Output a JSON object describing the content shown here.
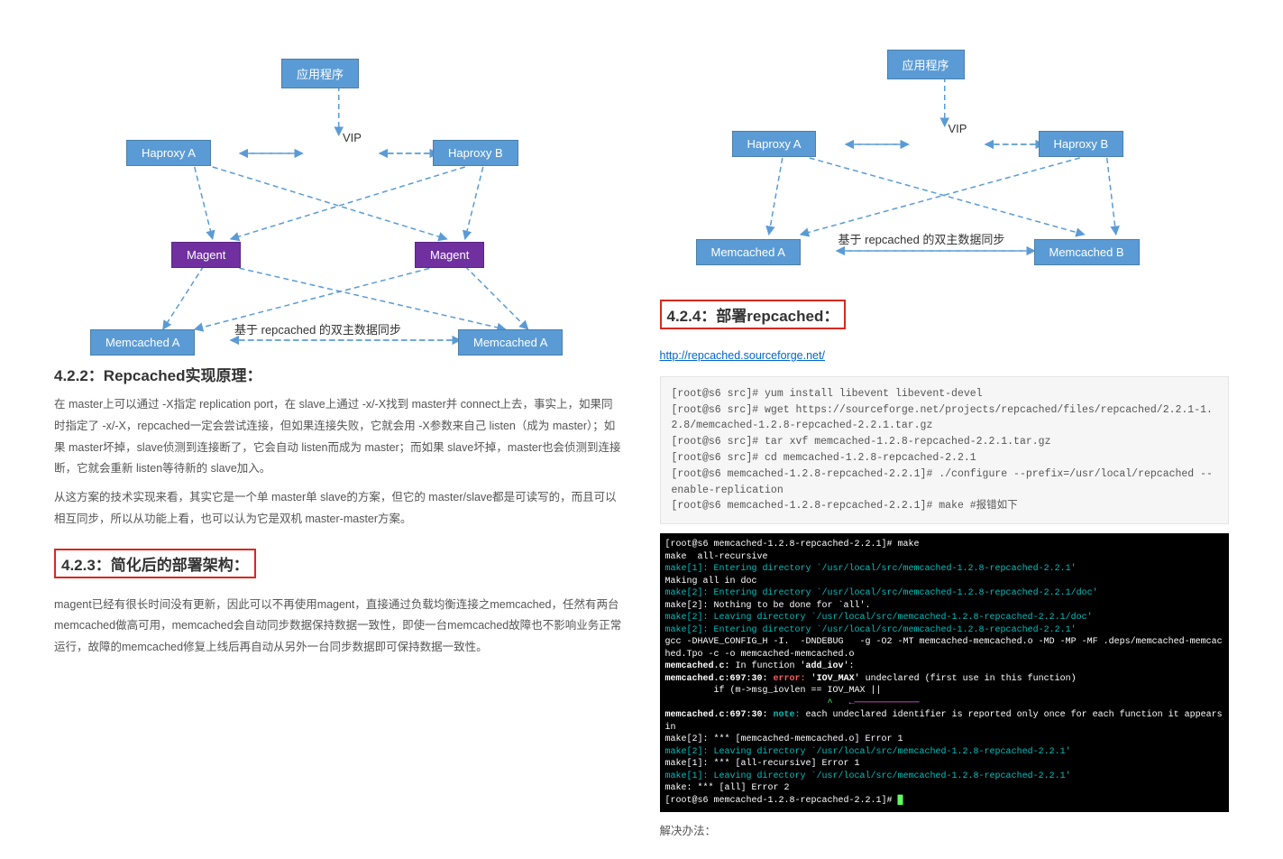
{
  "left": {
    "diag": {
      "app": "应用程序",
      "hapA": "Haproxy A",
      "hapB": "Haproxy B",
      "vip": "VIP",
      "magA": "Magent",
      "magB": "Magent",
      "memA": "Memcached A",
      "memB": "Memcached A",
      "caption": "基于 repcached 的双主数据同步"
    },
    "h422": "4.2.2：Repcached实现原理：",
    "p422a": "在 master上可以通过 -X指定 replication port，在 slave上通过 -x/-X找到 master并 connect上去，事实上，如果同时指定了 -x/-X，repcached一定会尝试连接，但如果连接失败，它就会用 -X参数来自己 listen（成为 master）；如果 master坏掉，slave侦测到连接断了，它会自动 listen而成为 master；而如果 slave坏掉，master也会侦测到连接断，它就会重新 listen等待新的 slave加入。",
    "p422b": "从这方案的技术实现来看，其实它是一个单 master单 slave的方案，但它的 master/slave都是可读写的，而且可以相互同步，所以从功能上看，也可以认为它是双机 master-master方案。",
    "h423": "4.2.3：简化后的部署架构：",
    "p423": "magent已经有很长时间没有更新，因此可以不再使用magent，直接通过负载均衡连接之memcached，任然有两台memcached做高可用，memcached会自动同步数据保持数据一致性，即使一台memcached故障也不影响业务正常运行，故障的memcached修复上线后再自动从另外一台同步数据即可保持数据一致性。"
  },
  "right": {
    "diag": {
      "app": "应用程序",
      "hapA": "Haproxy A",
      "hapB": "Haproxy B",
      "vip": "VIP",
      "memA": "Memcached A",
      "memB": "Memcached B",
      "caption": "基于 repcached 的双主数据同步"
    },
    "h424": "4.2.4：部署repcached：",
    "link": "http://repcached.sourceforge.net/",
    "code": "[root@s6 src]# yum install libevent libevent-devel\n[root@s6 src]# wget https://sourceforge.net/projects/repcached/files/repcached/2.2.1-1.2.8/memcached-1.2.8-repcached-2.2.1.tar.gz\n[root@s6 src]# tar xvf memcached-1.2.8-repcached-2.2.1.tar.gz\n[root@s6 src]# cd memcached-1.2.8-repcached-2.2.1\n[root@s6 memcached-1.2.8-repcached-2.2.1]# ./configure --prefix=/usr/local/repcached --enable-replication\n[root@s6 memcached-1.2.8-repcached-2.2.1]# make #报错如下",
    "term": {
      "l1": "[root@s6 memcached-1.2.8-repcached-2.2.1]# make",
      "l2": "make  all-recursive",
      "l3": "make[1]: Entering directory `/usr/local/src/memcached-1.2.8-repcached-2.2.1'",
      "l4": "Making all in doc",
      "l5": "make[2]: Entering directory `/usr/local/src/memcached-1.2.8-repcached-2.2.1/doc'",
      "l6": "make[2]: Nothing to be done for `all'.",
      "l7": "make[2]: Leaving directory `/usr/local/src/memcached-1.2.8-repcached-2.2.1/doc'",
      "l8": "make[2]: Entering directory `/usr/local/src/memcached-1.2.8-repcached-2.2.1'",
      "l9": "gcc -DHAVE_CONFIG_H -I.  -DNDEBUG   -g -O2 -MT memcached-memcached.o -MD -MP -MF .deps/memcached-memcached.Tpo -c -o memcached-memcached.o",
      "l10a": "memcached.c:",
      "l10b": " In function '",
      "l10c": "add_iov",
      "l10d": "':",
      "l11a": "memcached.c:697:30:",
      "l11b": " error:",
      "l11c": " '",
      "l11d": "IOV_MAX",
      "l11e": "' undeclared (first use in this function)",
      "l12": "         if (m->msg_iovlen == IOV_MAX ||",
      "l13": "                              ^",
      "l14a": "memcached.c:697:30:",
      "l14b": " note:",
      "l14c": " each undeclared identifier is reported only once for each function it appears in",
      "l15": "make[2]: *** [memcached-memcached.o] Error 1",
      "l16": "make[2]: Leaving directory `/usr/local/src/memcached-1.2.8-repcached-2.2.1'",
      "l17": "make[1]: *** [all-recursive] Error 1",
      "l18": "make[1]: Leaving directory `/usr/local/src/memcached-1.2.8-repcached-2.2.1'",
      "l19": "make: *** [all] Error 2",
      "l20": "[root@s6 memcached-1.2.8-repcached-2.2.1]# ",
      "cursor": "█"
    },
    "solve": "解决办法："
  }
}
